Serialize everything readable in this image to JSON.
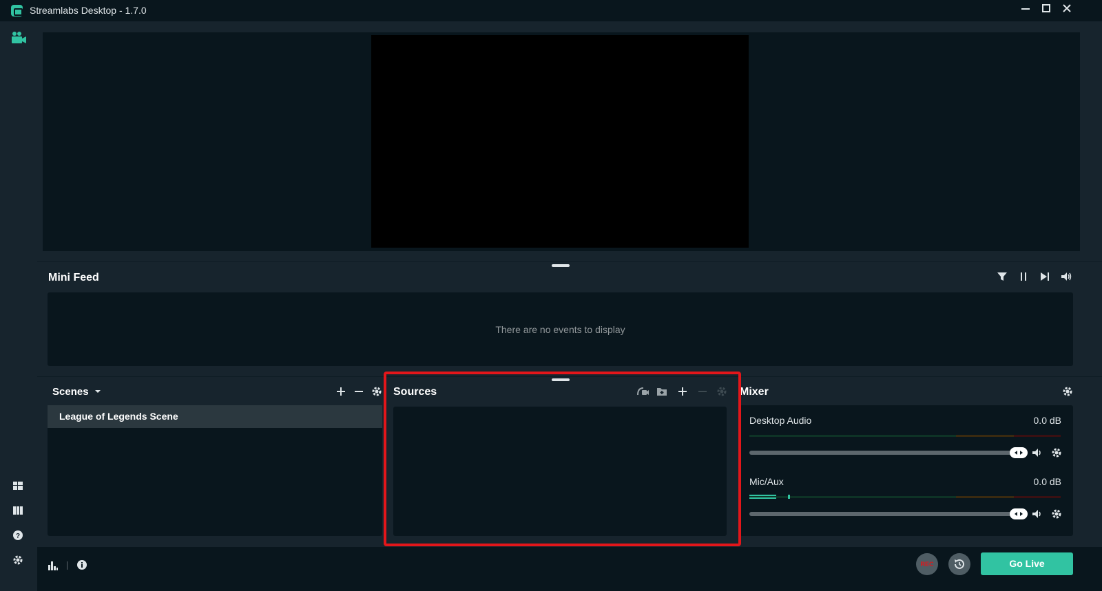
{
  "window": {
    "title": "Streamlabs Desktop - 1.7.0",
    "controls": [
      "minimize-icon",
      "maximize-icon",
      "close-icon"
    ]
  },
  "sidebar": {
    "top_icons": [
      "studio-camera-icon"
    ],
    "bottom_icons": [
      "layout-icon",
      "columns-icon",
      "help-icon",
      "settings-icon"
    ]
  },
  "mini_feed": {
    "title": "Mini Feed",
    "empty_text": "There are no events to display",
    "icons": [
      "filter-icon",
      "pause-icon",
      "skip-icon",
      "volume-icon"
    ]
  },
  "scenes": {
    "title": "Scenes",
    "items": [
      {
        "label": "League of Legends Scene",
        "selected": true
      }
    ],
    "icons": [
      "add-icon",
      "remove-icon",
      "gear-icon"
    ]
  },
  "sources": {
    "title": "Sources",
    "items": [],
    "icons": [
      "selective-recording-icon",
      "add-folder-icon",
      "add-icon",
      "remove-icon",
      "gear-icon"
    ]
  },
  "mixer": {
    "title": "Mixer",
    "channels": [
      {
        "name": "Desktop Audio",
        "db": "0.0 dB",
        "volume": 1.0,
        "level": 0.0
      },
      {
        "name": "Mic/Aux",
        "db": "0.0 dB",
        "volume": 1.0,
        "level": 0.13
      }
    ]
  },
  "footer": {
    "rec_label": "REC",
    "go_live_label": "Go Live",
    "icons": [
      "stats-icon",
      "info-icon",
      "replay-buffer-icon"
    ]
  },
  "colors": {
    "accent": "#31c3a2",
    "highlight": "#e3161a",
    "bg_dark": "#09161d",
    "bg_panel": "#17242d"
  }
}
